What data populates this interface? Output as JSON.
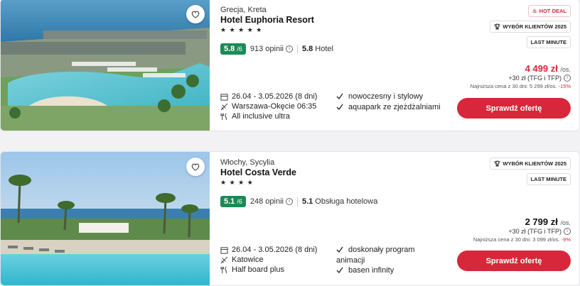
{
  "offers": [
    {
      "location": "Grecja, Kreta",
      "name": "Hotel Euphoria Resort",
      "stars": "★ ★ ★ ★ ★",
      "rating": "5.8",
      "rating_max": "/6",
      "reviews": "913 opinii",
      "score": "5.8",
      "score_label": "Hotel",
      "dates": "26.04 - 3.05.2026 (8 dni)",
      "departure": "Warszawa-Okęcie 06:35",
      "board": "All inclusive ultra",
      "features": [
        "nowoczesny i stylowy",
        "aquapark ze zjeżdżalniami"
      ],
      "badges": [
        "HOT DEAL",
        "WYBÓR KLIENTÓW 2025",
        "LAST MINUTE"
      ],
      "price": "4 499 zł",
      "per": "/os.",
      "extra": "+30 zł (TFG i TFP)",
      "lowest": "Najniższa cena z 30 dni: 5 299 zł/os.",
      "discount": "-15%",
      "cta": "Sprawdź ofertę"
    },
    {
      "location": "Włochy, Sycylia",
      "name": "Hotel Costa Verde",
      "stars": "★ ★ ★ ★",
      "rating": "5.1",
      "rating_max": "/6",
      "reviews": "248 opinii",
      "score": "5.1",
      "score_label": "Obsługa hotelowa",
      "dates": "26.04 - 3.05.2026 (8 dni)",
      "departure": "Katowice",
      "board": "Half board plus",
      "features": [
        "doskonały program",
        "animacji",
        "basen infinity"
      ],
      "badges": [
        "WYBÓR KLIENTÓW 2025",
        "LAST MINUTE"
      ],
      "price": "2 799 zł",
      "per": "/os.",
      "extra": "+30 zł (TFG i TFP)",
      "lowest": "Najniższa cena z 30 dni: 3 099 zł/os.",
      "discount": "-9%",
      "cta": "Sprawdź ofertę"
    }
  ],
  "colors": {
    "accent": "#d8273a",
    "rating": "#1c8a56"
  }
}
